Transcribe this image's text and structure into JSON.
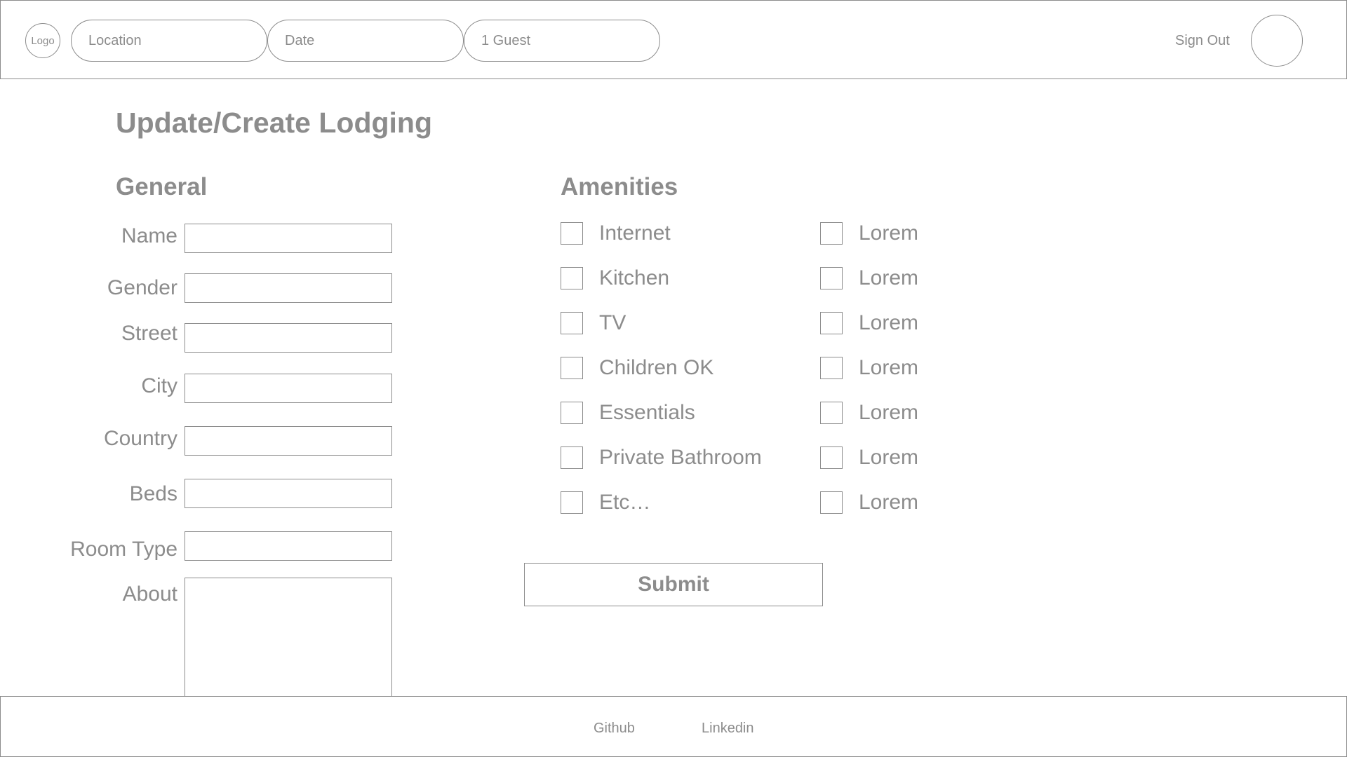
{
  "header": {
    "logo": "Logo",
    "search": {
      "location_placeholder": "Location",
      "date_placeholder": "Date",
      "guests_placeholder": "1 Guest"
    },
    "sign_out": "Sign Out"
  },
  "main": {
    "title": "Update/Create Lodging",
    "general": {
      "title": "General",
      "fields": [
        "Name",
        "Gender",
        "Street",
        "City",
        "Country",
        "Beds",
        "Room Type",
        "About"
      ]
    },
    "amenities": {
      "title": "Amenities",
      "column1": [
        "Internet",
        "Kitchen",
        "TV",
        "Children OK",
        "Essentials",
        "Private Bathroom",
        "Etc…"
      ],
      "column2": [
        "Lorem",
        "Lorem",
        "Lorem",
        "Lorem",
        "Lorem",
        "Lorem",
        "Lorem"
      ]
    },
    "submit_label": "Submit"
  },
  "footer": {
    "links": [
      "Github",
      "Linkedin"
    ]
  },
  "colors": {
    "line": "#8c8c8c",
    "background": "#ffffff"
  }
}
